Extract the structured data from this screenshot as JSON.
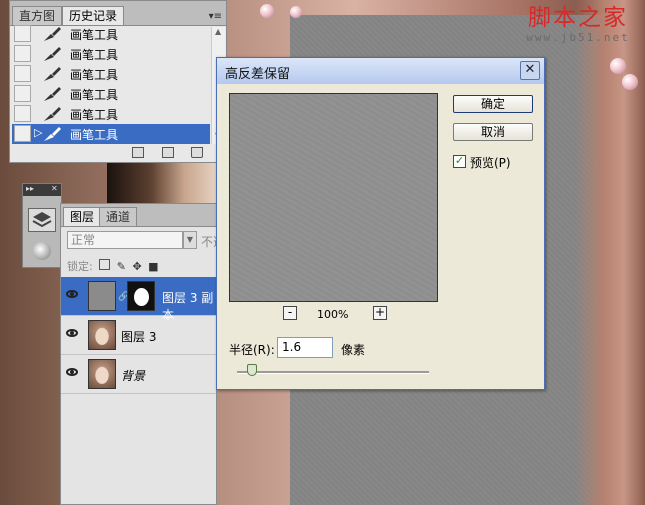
{
  "watermark": {
    "title": "脚本之家",
    "url": "www.jb51.net"
  },
  "history_panel": {
    "tabs": [
      "直方图",
      "历史记录"
    ],
    "active_tab": "历史记录",
    "items": [
      "画笔工具",
      "画笔工具",
      "画笔工具",
      "画笔工具",
      "画笔工具",
      "画笔工具"
    ],
    "selected_index": 5
  },
  "layers_panel": {
    "tabs": [
      "图层",
      "通道"
    ],
    "active_tab": "图层",
    "blend_mode": "正常",
    "opacity_label": "不透",
    "lock_label": "锁定:",
    "layers": [
      {
        "name": "图层 3 副本",
        "selected": true
      },
      {
        "name": "图层 3",
        "selected": false
      },
      {
        "name": "背景",
        "selected": false
      }
    ]
  },
  "dialog": {
    "title": "高反差保留",
    "ok_label": "确定",
    "cancel_label": "取消",
    "preview_label": "预览(P)",
    "preview_checked": true,
    "zoom_level": "100%",
    "zoom_out": "-",
    "zoom_in": "+",
    "radius_label": "半径(R):",
    "radius_value": "1.6",
    "unit_label": "像素",
    "close_glyph": "✕"
  },
  "colors": {
    "selection_blue": "#3a6cc4",
    "dialog_bg": "#ece9d8",
    "watermark_red": "#d62a2a"
  }
}
